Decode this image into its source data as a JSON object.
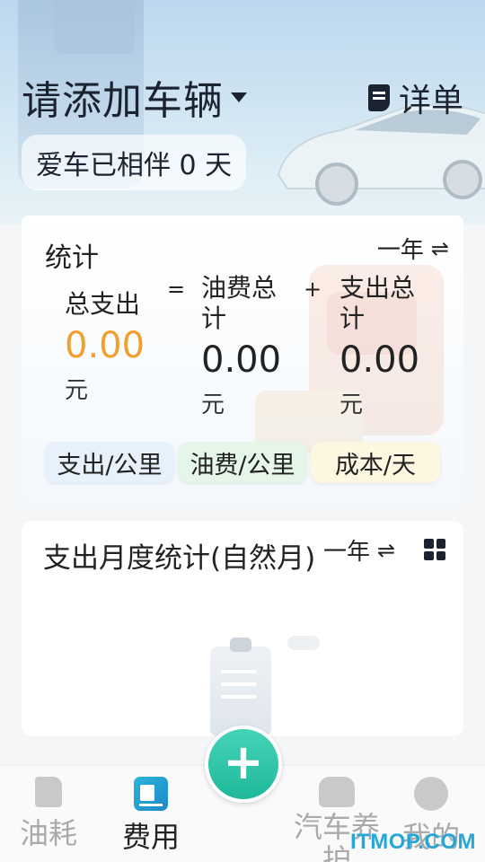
{
  "header": {
    "vehicle_title": "请添加车辆",
    "detail_label": "详单",
    "companion_text": "爱车已相伴 0 天"
  },
  "stats": {
    "title": "统计",
    "period": "一年",
    "total": {
      "label": "总支出",
      "value": "0.00",
      "unit": "元"
    },
    "equals": "=",
    "fuel": {
      "label": "油费总计",
      "value": "0.00",
      "unit": "元"
    },
    "plus": "+",
    "expense": {
      "label": "支出总计",
      "value": "0.00",
      "unit": "元"
    },
    "pills": [
      "支出/公里",
      "油费/公里",
      "成本/天"
    ]
  },
  "monthly": {
    "title": "支出月度统计(自然月)",
    "period": "一年"
  },
  "tabbar": {
    "fuel": "油耗",
    "cost": "费用",
    "maintenance": "汽车养护",
    "me": "我的",
    "active": "cost"
  },
  "fab_symbol": "+",
  "watermark": "ITMOP.COM",
  "colors": {
    "total_value": "#f0a030",
    "fab": "#2bc4a6",
    "cost_tab_icon": "#1e88c8"
  }
}
